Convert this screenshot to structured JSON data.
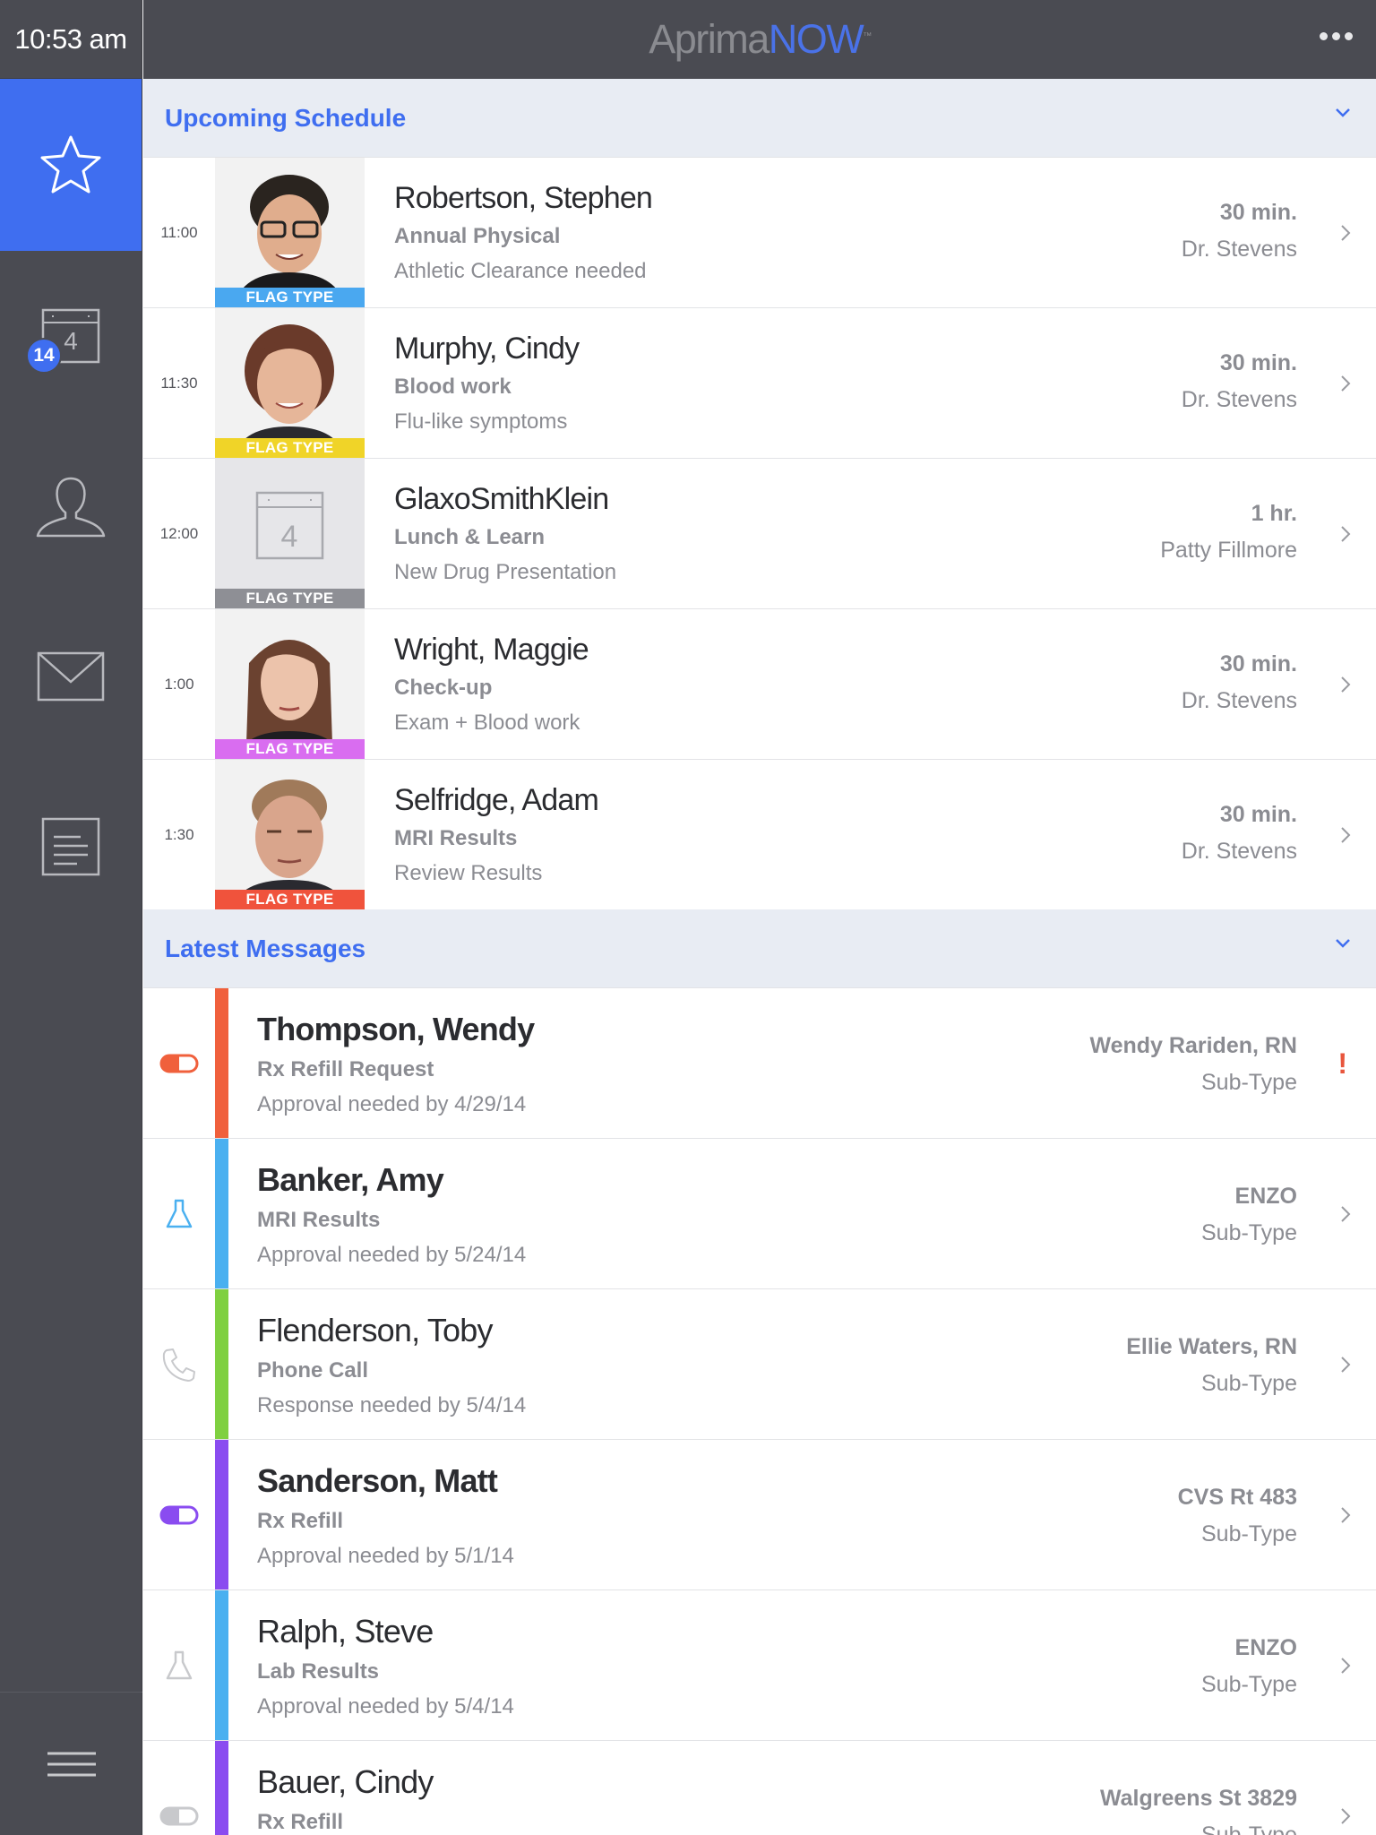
{
  "status": {
    "time": "10:53 am"
  },
  "app": {
    "logo_part1": "Aprima",
    "logo_part2": "NOW",
    "logo_tm": "™"
  },
  "sidebar": {
    "calendar_badge": "14",
    "calendar_day": "4"
  },
  "schedule": {
    "title": "Upcoming Schedule",
    "items": [
      {
        "time": "11:00",
        "name": "Robertson, Stephen",
        "type": "Annual Physical",
        "note": "Athletic Clearance needed",
        "duration": "30 min.",
        "provider": "Dr. Stevens",
        "flag": "FLAG TYPE",
        "flag_color": "#4aa8f0"
      },
      {
        "time": "11:30",
        "name": "Murphy, Cindy",
        "type": "Blood work",
        "note": "Flu-like symptoms",
        "duration": "30 min.",
        "provider": "Dr. Stevens",
        "flag": "FLAG TYPE",
        "flag_color": "#f0d428"
      },
      {
        "time": "12:00",
        "name": "GlaxoSmithKlein",
        "type": "Lunch & Learn",
        "note": "New Drug Presentation",
        "duration": "1 hr.",
        "provider": "Patty Fillmore",
        "flag": "FLAG TYPE",
        "flag_color": "#8e8f95",
        "calendar_day": "4"
      },
      {
        "time": "1:00",
        "name": "Wright, Maggie",
        "type": "Check-up",
        "note": "Exam + Blood work",
        "duration": "30 min.",
        "provider": "Dr. Stevens",
        "flag": "FLAG TYPE",
        "flag_color": "#d96df0"
      },
      {
        "time": "1:30",
        "name": "Selfridge, Adam",
        "type": "MRI Results",
        "note": "Review Results",
        "duration": "30 min.",
        "provider": "Dr. Stevens",
        "flag": "FLAG TYPE",
        "flag_color": "#f0533c"
      }
    ]
  },
  "messages": {
    "title": "Latest Messages",
    "items": [
      {
        "name": "Thompson, Wendy",
        "type": "Rx Refill Request",
        "note": "Approval needed by 4/29/14",
        "from": "Wendy Rariden, RN",
        "subtype": "Sub-Type",
        "bar_color": "#f0603c",
        "icon": "pill-icon",
        "icon_color": "#f0603c",
        "alert": "!"
      },
      {
        "name": "Banker, Amy",
        "type": "MRI Results",
        "note": "Approval needed by 5/24/14",
        "from": "ENZO",
        "subtype": "Sub-Type",
        "bar_color": "#4ab0f0",
        "icon": "flask-icon",
        "icon_color": "#4ab0f0"
      },
      {
        "name": "Flenderson, Toby",
        "type": "Phone Call",
        "note": "Response needed by 5/4/14",
        "from": "Ellie Waters, RN",
        "subtype": "Sub-Type",
        "bar_color": "#7fd040",
        "icon": "phone-icon",
        "icon_color": "#c8c9cc"
      },
      {
        "name": "Sanderson, Matt",
        "type": "Rx Refill",
        "note": "Approval needed by 5/1/14",
        "from": "CVS Rt 483",
        "subtype": "Sub-Type",
        "bar_color": "#8a4cf0",
        "icon": "pill-icon",
        "icon_color": "#8a4cf0"
      },
      {
        "name": "Ralph, Steve",
        "type": "Lab Results",
        "note": "Approval needed by 5/4/14",
        "from": "ENZO",
        "subtype": "Sub-Type",
        "bar_color": "#4ab0f0",
        "icon": "flask-icon",
        "icon_color": "#c8c9cc"
      },
      {
        "name": "Bauer, Cindy",
        "type": "Rx Refill",
        "note": "",
        "from": "Walgreens St 3829",
        "subtype": "Sub-Type",
        "bar_color": "#8a4cf0",
        "icon": "pill-icon",
        "icon_color": "#c8c9cc"
      }
    ]
  }
}
